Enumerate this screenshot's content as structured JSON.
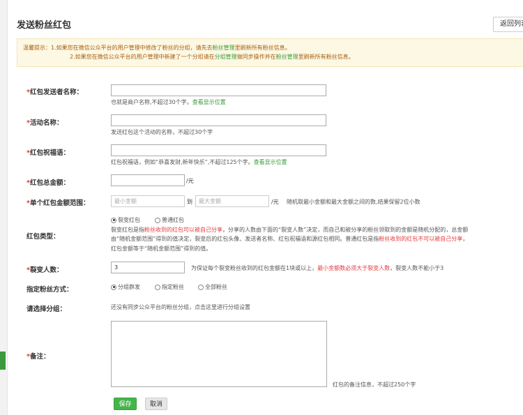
{
  "page": {
    "title": "发送粉丝红包",
    "back_label": "返回列表"
  },
  "tips": {
    "prefix": "温馨提示：",
    "line1": "1.如果您在微信公众平台的用户管理中修改了粉丝的分组，请先去",
    "line1_link": "粉丝管理",
    "line1_suffix": "里刷新所有粉丝信息。",
    "line2": "2.如果您在微信公众平台的用户管理中新建了一个分组请在",
    "line2_link1": "分组管理",
    "line2_mid": "做同步操作并在",
    "line2_link2": "粉丝管理",
    "line2_suffix": "里刷新所有粉丝信息。"
  },
  "form": {
    "sender": {
      "label": "红包发送者名称：",
      "value": "",
      "hint": "也就是商户名称,不超过30个字。",
      "link": "查看显示位置"
    },
    "activity": {
      "label": "活动名称：",
      "value": "",
      "hint": "发送红包这个活动的名称，不超过30个字"
    },
    "wishing": {
      "label": "红包祝福语：",
      "value": "",
      "hint": "红包祝福语，例如“恭喜发财,新年快乐”,不超过125个字。",
      "link": "查看显示位置"
    },
    "total": {
      "label": "红包总金额：",
      "value": "",
      "unit": "/元"
    },
    "range": {
      "label": "单个红包金额范围：",
      "min_placeholder": "最小金额",
      "to": "到",
      "max_placeholder": "最大金额",
      "unit": "/元",
      "hint": "随机取最小金额和最大金额之间的数,结果保留2位小数"
    },
    "type": {
      "label": "红包类型：",
      "option1": "裂变红包",
      "option2": "普通红包",
      "desc1": "裂变红包是指",
      "desc1_red": "粉丝收到的红包可以被自己分享",
      "desc1_rest": "，分享的人数由下面的“裂变人数”决定，而自己和被分享的粉丝领取到的金额是随机分配的，总金额",
      "desc2": "由“随机金额范围”得到的值决定，裂变后的红包头像、发送者名称、红包祝福语和源红包相同。普通红包是指",
      "desc2_red": "粉丝收到的红包不可以被自己分享",
      "desc2_rest": "，",
      "desc3": "红包金额等于“随机金额范围”得到的值。"
    },
    "fission": {
      "label": "裂变人数：",
      "value": "3",
      "hint_pre": "为保证每个裂变粉丝收到的红包金额在1块或以上，",
      "hint_red": "最小金额数必须大于裂变人数",
      "hint_post": "，裂变人数不能小于3"
    },
    "method": {
      "label": "指定粉丝方式：",
      "option1": "分组群发",
      "option2": "指定粉丝",
      "option3": "全部粉丝"
    },
    "group": {
      "label": "请选择分组：",
      "text": "还没有同步公众平台的粉丝分组，点击这里进行分组设置"
    },
    "remark": {
      "label": "备注：",
      "value": "",
      "hint": "红包的备注信息，不超过250个字"
    }
  },
  "buttons": {
    "save": "保存",
    "cancel": "取消"
  },
  "colors": {
    "accent_green": "#44b549",
    "required_red": "#e4393c",
    "tips_bg": "#fcf8e3"
  }
}
